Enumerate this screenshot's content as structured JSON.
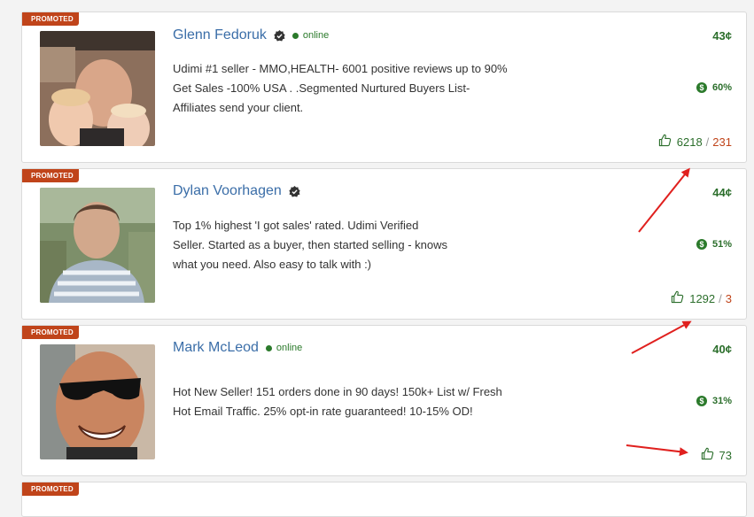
{
  "badge_label": "PROMOTED",
  "sellers": [
    {
      "name": "Glenn Fedoruk",
      "verified": true,
      "online": true,
      "online_label": "online",
      "description": [
        "Udimi #1 seller - MMO,HEALTH- 6001 positive reviews up to 90%",
        "Get Sales -100% USA . .Segmented Nurtured Buyers List-",
        "Affiliates send your client."
      ],
      "price": "43¢",
      "sales_percent": "60%",
      "reviews_positive": "6218",
      "reviews_separator": "/",
      "reviews_negative": "231"
    },
    {
      "name": "Dylan Voorhagen",
      "verified": true,
      "online": false,
      "online_label": "",
      "description": [
        "Top 1% highest 'I got sales' rated. Udimi Verified",
        "Seller. Started as a buyer, then started selling - knows",
        "what you need. Also easy to talk with :)"
      ],
      "price": "44¢",
      "sales_percent": "51%",
      "reviews_positive": "1292",
      "reviews_separator": "/",
      "reviews_negative": "3"
    },
    {
      "name": "Mark McLeod",
      "verified": false,
      "online": true,
      "online_label": "online",
      "description": [
        "Hot New Seller! 151 orders done in 90 days! 150k+ List w/ Fresh",
        "Hot Email Traffic. 25% opt-in rate guaranteed! 10-15% OD!"
      ],
      "price": "40¢",
      "sales_percent": "31%",
      "reviews_positive": "73",
      "reviews_separator": "",
      "reviews_negative": ""
    }
  ],
  "icons": {
    "verified": "verified-badge-icon",
    "coin": "dollar-coin-icon",
    "thumb": "thumbs-up-icon",
    "arrow": "red-arrow-annotation"
  },
  "coin_symbol": "$",
  "colors": {
    "badge": "#c0441a",
    "name": "#3b6ea8",
    "green": "#2b6e2b",
    "negative": "#c0441a",
    "arrow": "#e0201e"
  }
}
